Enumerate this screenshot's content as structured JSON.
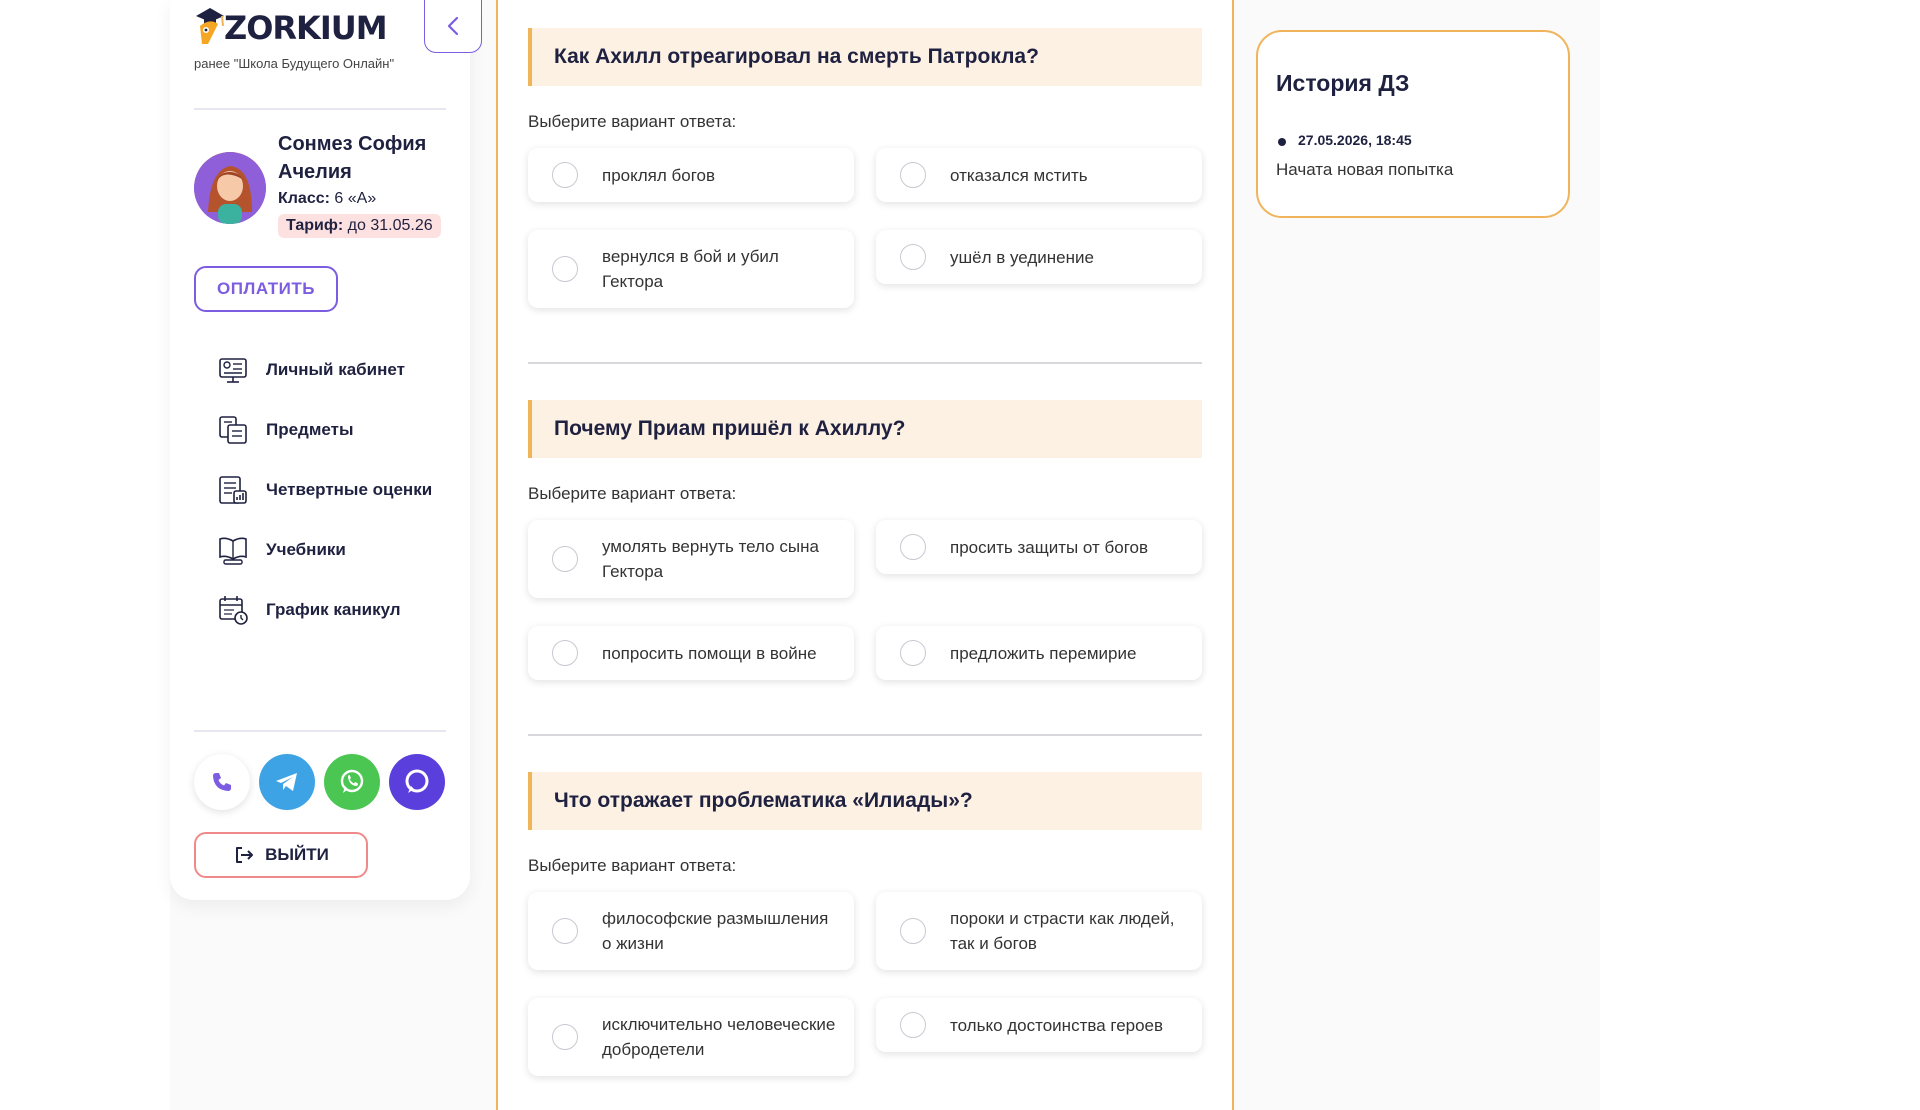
{
  "brand": {
    "logo_text": "ZORKIUM",
    "subtitle": "ранее \"Школа Будущего Онлайн\""
  },
  "profile": {
    "name": "Сонмез София Ачелия",
    "class_label": "Класс:",
    "class_value": "6 «А»",
    "tariff_label": "Тариф:",
    "tariff_value": "до 31.05.26"
  },
  "pay_button": "ОПЛАТИТЬ",
  "nav": [
    {
      "label": "Личный кабинет",
      "icon": "dashboard-icon"
    },
    {
      "label": "Предметы",
      "icon": "subjects-icon"
    },
    {
      "label": "Четвертные оценки",
      "icon": "grades-icon"
    },
    {
      "label": "Учебники",
      "icon": "textbook-icon"
    },
    {
      "label": "График каникул",
      "icon": "calendar-icon"
    }
  ],
  "socials": [
    "phone-icon",
    "telegram-icon",
    "whatsapp-icon",
    "chat-icon"
  ],
  "logout_button": "ВЫЙТИ",
  "questions": [
    {
      "title": "Как Ахилл отреагировал на смерть Патрокла?",
      "hint": "Выберите вариант ответа:",
      "options": [
        "проклял богов",
        "отказался мстить",
        "вернулся в бой и убил Гектора",
        "ушёл в уединение"
      ]
    },
    {
      "title": "Почему Приам пришёл к Ахиллу?",
      "hint": "Выберите вариант ответа:",
      "options": [
        "умолять вернуть тело сына Гектора",
        "просить защиты от богов",
        "попросить помощи в войне",
        "предложить перемирие"
      ]
    },
    {
      "title": "Что отражает проблематика «Илиады»?",
      "hint": "Выберите вариант ответа:",
      "options": [
        "философские размышления о жизни",
        "пороки и страсти как людей, так и богов",
        "исключительно человеческие добродетели",
        "только достоинства героев"
      ]
    }
  ],
  "history": {
    "title": "История ДЗ",
    "entries": [
      {
        "time": "27.05.2026, 18:45",
        "text": "Начата новая попытка"
      }
    ]
  },
  "colors": {
    "accent_purple": "#7c5ce0",
    "accent_orange": "#f0b45a",
    "question_bg": "#fdf1e4",
    "tariff_bg": "#fde1e1",
    "logout_border": "#f08a8a"
  }
}
